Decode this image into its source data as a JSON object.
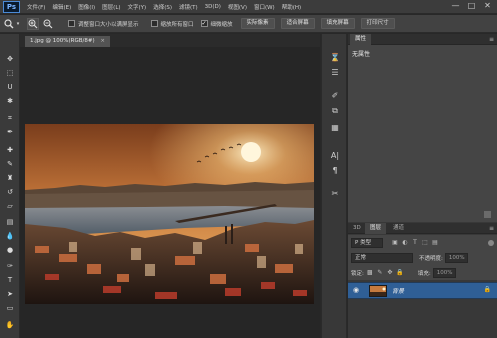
{
  "app": {
    "logo": "Ps"
  },
  "menu": [
    "文件(F)",
    "编辑(E)",
    "图像(I)",
    "图层(L)",
    "文字(Y)",
    "选择(S)",
    "滤镜(T)",
    "3D(D)",
    "视图(V)",
    "窗口(W)",
    "帮助(H)"
  ],
  "window_controls": {
    "minimize": "—",
    "maximize": "□",
    "close": "✕"
  },
  "options": {
    "resize_windows_label": "调整窗口大小以满屏显示",
    "zoom_all_label": "缩放所有窗口",
    "scrubby_zoom_label": "细微缩放",
    "scrubby_zoom_checked": "✓",
    "actual_pixels_label": "实际像素",
    "fit_screen_label": "适合屏幕",
    "fill_screen_label": "填充屏幕",
    "print_size_label": "打印尺寸"
  },
  "document": {
    "tab_label": "1.jpg @ 100%(RGB/8#)",
    "tab_close": "×"
  },
  "properties_panel": {
    "tab_label": "属性",
    "no_properties": "无属性"
  },
  "layers_panel": {
    "tabs": [
      "3D",
      "图层",
      "通道"
    ],
    "active_tab": "图层",
    "filter_kind": "P 类型",
    "blend_mode": "正常",
    "opacity_label": "不透明度:",
    "opacity_value": "100%",
    "lock_label": "锁定:",
    "fill_label": "填充:",
    "fill_value": "100%",
    "layer_name": "背景"
  },
  "colors": {
    "accent": "#2f5f96",
    "menu_bg": "#3c3c3c",
    "panel_bg": "#383838",
    "canvas_bg": "#262626"
  }
}
